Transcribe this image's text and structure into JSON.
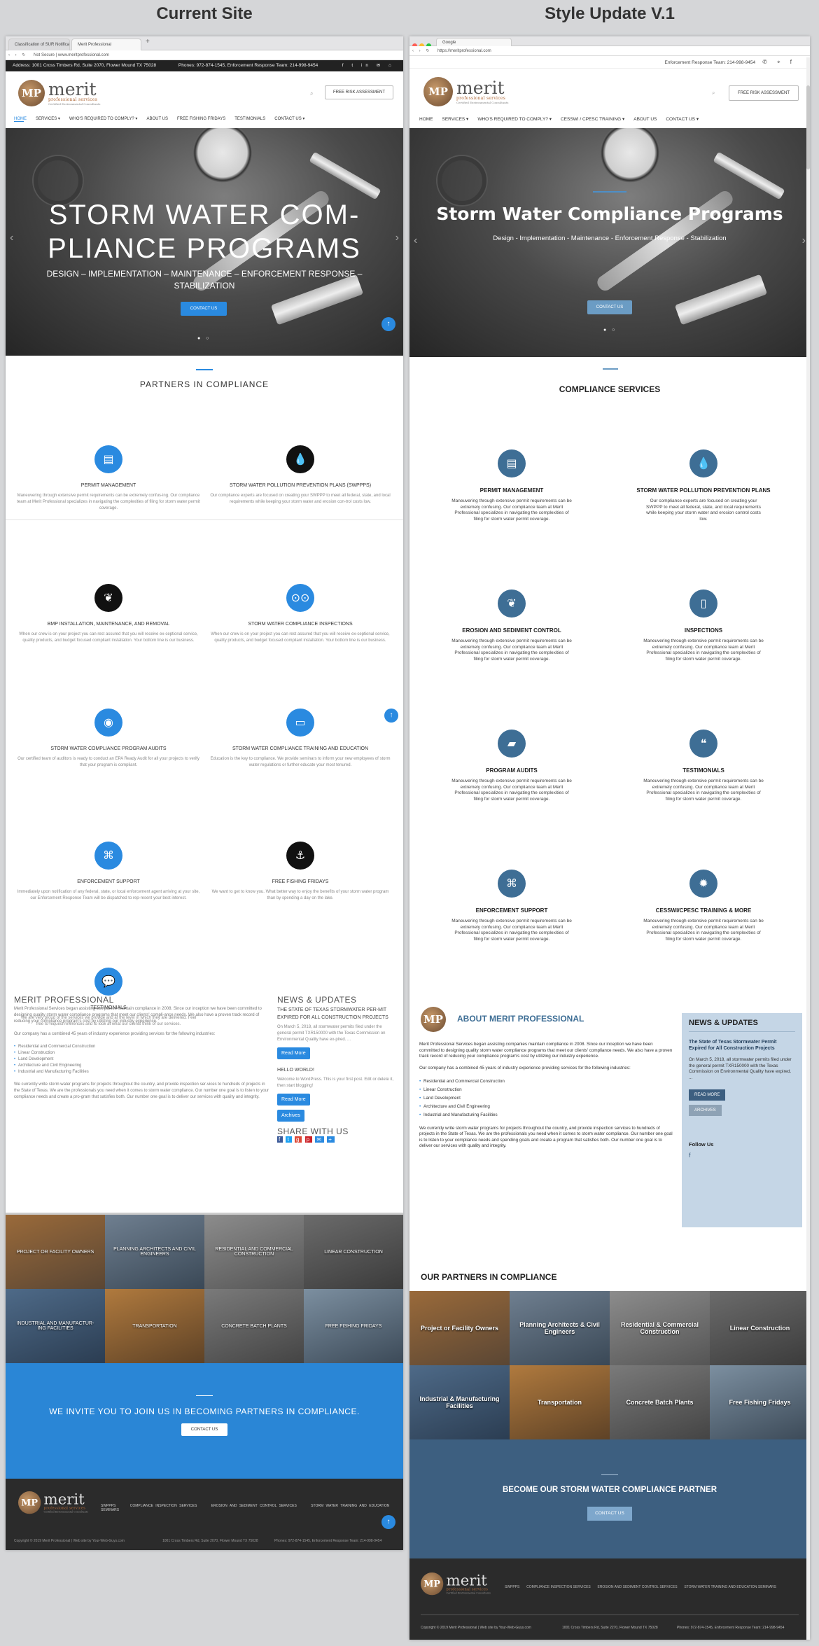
{
  "headings": {
    "left": "Current Site",
    "right": "Style Update V.1"
  },
  "left": {
    "tabs": [
      "Classification of SUR Notifica...",
      "Merit Professional"
    ],
    "url": "Not Secure  |  www.meritprofessional.com",
    "topbar": {
      "address": "Address: 1001 Cross Timbers Rd, Suite 2070, Flower Mound TX 75028",
      "phones": "Phones: 972-874-1545, Enforcement Response Team: 214-998-9454"
    },
    "logo": {
      "letters": "MP",
      "name": "merit",
      "tagline": "professional services",
      "sub": "Certified Environmental Consultants"
    },
    "cta": "FREE RISK ASSESSMENT",
    "nav": [
      "HOME",
      "SERVICES ▾",
      "WHO'S REQUIRED TO COMPLY? ▾",
      "ABOUT US",
      "FREE FISHING FRIDAYS",
      "TESTIMONIALS",
      "CONTACT US ▾"
    ],
    "hero": {
      "title1": "STORM WATER COM-",
      "title2": "PLIANCE PROGRAMS",
      "sub1": "DESIGN – IMPLEMENTATION – MAINTENANCE – ENFORCEMENT RESPONSE –",
      "sub2": "STABILIZATION",
      "button": "CONTACT US"
    },
    "partners_title": "PARTNERS IN COMPLIANCE",
    "services": [
      {
        "title": "PERMIT MANAGEMENT",
        "icon": "document-icon",
        "color": "#2a8ae0",
        "text": "Maneuvering through extensive permit requirements can be extremely confus-ing. Our compliance team at Merit Professional specializes in navigating the complexities of filing for storm water permit coverage."
      },
      {
        "title": "STORM WATER POLLUTION PREVENTION PLANS (SWPPPS)",
        "icon": "drop-icon",
        "color": "#111111",
        "text": "Our compliance experts are focused on creating your SWPPP to meet all federal, state, and local requirements while keeping your storm water and erosion con-trol costs low."
      },
      {
        "title": "BMP INSTALLATION, MAINTENANCE, AND REMOVAL",
        "icon": "leaf-icon",
        "color": "#111111",
        "text": "When our crew is on your project you can rest assured that you will receive ex-ceptional service, quality products, and budget focused compliant installation. Your bottom line is our business."
      },
      {
        "title": "STORM WATER COMPLIANCE INSPECTIONS",
        "icon": "binoculars-icon",
        "color": "#2a8ae0",
        "text": "When our crew is on your project you can rest assured that you will receive ex-ceptional service, quality products, and budget focused compliant installation. Your bottom line is our business."
      },
      {
        "title": "STORM WATER COMPLIANCE PROGRAM AUDITS",
        "icon": "eye-icon",
        "color": "#2a8ae0",
        "text": "Our certified team of auditors is ready to conduct an EPA Ready Audit for all your projects to verify that your program is compliant."
      },
      {
        "title": "STORM WATER COMPLIANCE TRAINING AND EDUCATION",
        "icon": "book-icon",
        "color": "#2a8ae0",
        "text": "Education is the key to compliance. We provide seminars to inform your new employees of storm water regulations or further educate your most tenured."
      },
      {
        "title": "ENFORCEMENT SUPPORT",
        "icon": "handshake-icon",
        "color": "#2a8ae0",
        "text": "Immediately upon notification of any federal, state, or local enforcement agent arriving at your site, our Enforcement Response Team will be dispatched to rep-resent your best interest."
      },
      {
        "title": "FREE FISHING FRIDAYS",
        "icon": "anchor-icon",
        "color": "#111111",
        "text": "We want to get to know you. What better way to enjoy the benefits of your storm water program than by spending a day on the lake."
      },
      {
        "title": "TESTIMONIALS",
        "icon": "chat-icon",
        "color": "#2a8ae0",
        "text": "We are very proud of the services we provide and at the level in which they are delivered. Feel free to request references and to look at what our clients think of our services."
      }
    ],
    "about": {
      "title": "MERIT PROFESSIONAL",
      "p1": "Merit Professional Services began assisting companies maintain compliance in 2008. Since our inception we have been committed to designing quality storm water compliance programs that meet our clients' compli-ance needs. We also have a proven track record of reducing your compliance program's cost by utilizing our industry experience.",
      "p2": "Our company has a combined 45 years of industry experience providing services for the following industries:",
      "list": [
        "Residential and Commercial Construction",
        "Linear Construction",
        "Land Development",
        "Architecture and Civil Engineering",
        "Industrial and Manufacturing Facilities"
      ],
      "p3": "We currently write storm water programs for projects throughout the country, and provide inspection ser-vices to hundreds of projects in the State of Texas. We are the professionals you need when it comes to storm water compliance. Our number one goal is to listen to your compliance needs and create a pro-gram that satisfies both. Our number one goal is to deliver our services with quality and integrity."
    },
    "news": {
      "title": "NEWS & UPDATES",
      "headline": "THE STATE OF TEXAS STORMWATER PER-MIT EXPIRED FOR ALL CONSTRUCTION PROJECTS",
      "body": "On March 5, 2018, all stormwater permits filed under the general permit TXR150000 with the Texas Commission on Environmental Quality have ex-pired. ...",
      "read": "Read More",
      "hello": "HELLO WORLD!",
      "hello_body": "Welcome to WordPress. This is your first post. Edit or delete it, then start blogging!",
      "read2": "Read More",
      "archives": "Archives",
      "share": "SHARE WITH US"
    },
    "tiles": [
      "PROJECT OR FACILITY OWNERS",
      "PLANNING ARCHITECTS AND CIVIL ENGINEERS",
      "RESIDENTIAL AND COMMERCIAL CONSTRUCTION",
      "LINEAR CONSTRUCTION",
      "INDUSTRIAL AND MANUFACTUR-ING FACILITIES",
      "TRANSPORTATION",
      "CONCRETE BATCH PLANTS",
      "FREE FISHING FRIDAYS"
    ],
    "invite": {
      "text": "WE INVITE YOU TO JOIN US IN BECOMING PARTNERS IN COMPLIANCE.",
      "button": "CONTACT US"
    },
    "footer": {
      "links": [
        "SWPPPS",
        "COMPLIANCE INSPECTION SERVICES",
        "EROSION AND SEDIMENT CONTROL SERVICES",
        "STORM WATER TRAINING AND EDUCATION SEMINARS"
      ],
      "copy": "Copyright © 2019 Merit Professional  |  Web site by Your-Web-Guys.com",
      "addr": "1001 Cross Timbers Rd, Suite 2070, Flower Mound TX 75028",
      "phones": "Phones: 972-874-1545, Enforcement Response Team: 214-998-9454"
    }
  },
  "right": {
    "tab": "Google",
    "url": "https://meritprofessional.com",
    "topbar": "Enforcement Response Team: 214-998-9454",
    "logo": {
      "letters": "MP",
      "name": "merit",
      "tagline": "professional services",
      "sub": "Certified Environmental Consultants"
    },
    "cta": "FREE RISK ASSESSMENT",
    "nav": [
      "HOME",
      "SERVICES ▾",
      "WHO'S REQUIRED TO COMPLY? ▾",
      "CESSWI / CPESC TRAINING ▾",
      "ABOUT US",
      "CONTACT US ▾"
    ],
    "hero": {
      "title": "Storm Water Compliance Programs",
      "sub": "Design - Implementation - Maintenance - Enforcement Response - Stabilization",
      "button": "CONTACT US"
    },
    "services_title": "COMPLIANCE SERVICES",
    "services": [
      {
        "title": "PERMIT MANAGEMENT",
        "icon": "document-icon"
      },
      {
        "title": "STORM WATER POLLUTION PREVENTION PLANS",
        "icon": "drop-icon",
        "text": "Our compliance experts are focused on creating your SWPPP to meet all federal, state, and local requirements while keeping your storm water and erosion control costs low."
      },
      {
        "title": "EROSION AND SEDIMENT CONTROL",
        "icon": "leaf-icon"
      },
      {
        "title": "INSPECTIONS",
        "icon": "clipboard-icon"
      },
      {
        "title": "PROGRAM AUDITS",
        "icon": "folder-icon"
      },
      {
        "title": "TESTIMONIALS",
        "icon": "quote-icon"
      },
      {
        "title": "ENFORCEMENT SUPPORT",
        "icon": "handshake-icon"
      },
      {
        "title": "CESSWI/CPESC TRAINING & MORE",
        "icon": "badge-icon"
      }
    ],
    "service_text": "Maneuvering through extensive permit requirements can be extremely confusing. Our compliance team at Merit Professional specializes in navigating the complexities of filing for storm water permit coverage.",
    "about": {
      "title": "ABOUT MERIT PROFESSIONAL",
      "p1": "Merit Professional Services began assisting companies maintain compliance in 2008. Since our inception we have been committed to designing quality storm water compliance programs that meet our clients' compliance needs. We also have a proven track record of reducing your compliance program's cost by utilizing our industry experience.",
      "p2": "Our company has a combined 45 years of industry experience providing services for the following industries:",
      "list": [
        "Residential and Commercial Construction",
        "Linear Construction",
        "Land Development",
        "Architecture and Civil Engineering",
        "Industrial and Manufacturing Facilities"
      ],
      "p3": "We currently write storm water programs for projects throughout the country, and provide inspection services to hundreds of projects in the State of Texas. We are the professionals you need when it comes to storm water compliance. Our number one goal is to listen to your compliance needs and spending goals and create a program that satisfies both. Our number one goal is to deliver our services with quality and integrity."
    },
    "news": {
      "title": "NEWS & UPDATES",
      "headline": "The State of Texas Stormwater Permit Expired for All Construction Projects",
      "body": "On March 5, 2018, all stormwater permits filed under the general permit TXR150000 with the Texas Commission on Environmental Quality have expired. ...",
      "read": "READ MORE",
      "archives": "ARCHIVES",
      "follow": "Follow Us"
    },
    "partners_title": "OUR PARTNERS IN COMPLIANCE",
    "tiles": [
      "Project or Facility Owners",
      "Planning Architects & Civil Engineers",
      "Residential & Commercial Construction",
      "Linear Construction",
      "Industrial & Manufacturing Facilities",
      "Transportation",
      "Concrete Batch Plants",
      "Free Fishing Fridays"
    ],
    "invite": {
      "text": "BECOME OUR STORM WATER COMPLIANCE PARTNER",
      "button": "CONTACT US"
    },
    "footer": {
      "links": [
        "SWPPPS",
        "COMPLIANCE INSPECTION SERVICES",
        "EROSION AND SEDIMENT CONTROL SERVICES",
        "STORM WATER TRAINING AND EDUCATION SEMINARS"
      ],
      "copy": "Copyright © 2019 Merit Professional  |  Web site by Your-Web-Guys.com",
      "addr": "1001 Cross Timbers Rd, Suite 2270, Flower Mound TX 75028",
      "phones": "Phones: 972-874-1545, Enforcement Response Team: 214-998-9454"
    }
  },
  "colors": {
    "accent_left": "#2a8ae0",
    "accent_right": "#3e6e95",
    "invite_left": "#2a86d6",
    "invite_right": "#3d5f80",
    "news_bg": "#c5d6e6"
  }
}
